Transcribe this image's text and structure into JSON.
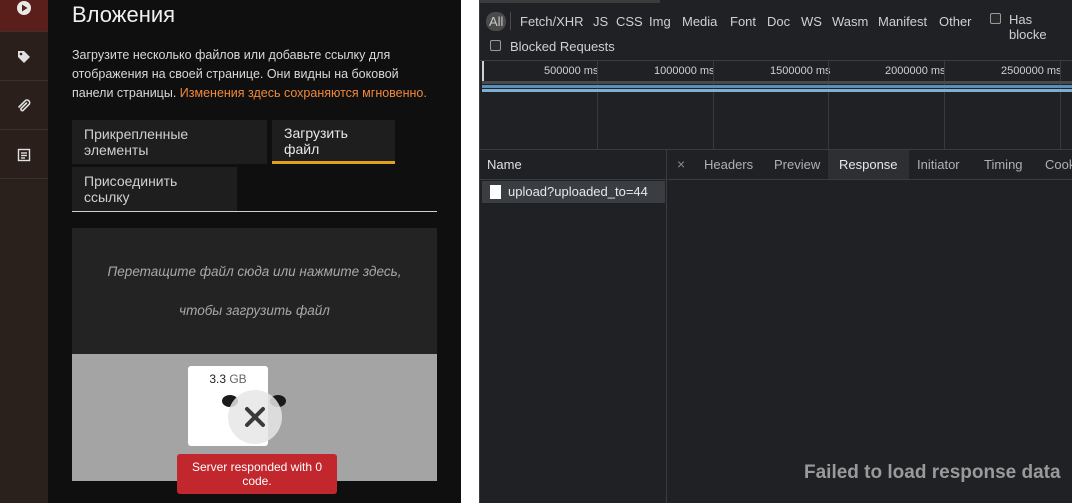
{
  "sidebar": {
    "icons": [
      "play-icon",
      "tag-icon",
      "paperclip-icon",
      "list-icon"
    ]
  },
  "panel": {
    "title": "Вложения",
    "description": "Загрузите несколько файлов или добавьте ссылку для отображения на своей странице. Они видны на боковой панели страницы.",
    "description_highlight": "Изменения здесь сохраняются мгновенно.",
    "tabs": [
      {
        "label": "Прикрепленные элементы"
      },
      {
        "label": "Загрузить файл"
      },
      {
        "label": "Присоединить ссылку"
      }
    ],
    "dropzone": {
      "line1": "Перетащите файл сюда или нажмите здесь,",
      "line2": "чтобы загрузить файл"
    },
    "file": {
      "size": "3.3",
      "unit": "GB",
      "error": "Server responded with 0 code."
    }
  },
  "devtools": {
    "filters": [
      "All",
      "Fetch/XHR",
      "JS",
      "CSS",
      "Img",
      "Media",
      "Font",
      "Doc",
      "WS",
      "Wasm",
      "Manifest",
      "Other"
    ],
    "has_blocked_label": "Has blocke",
    "blocked_requests_label": "Blocked Requests",
    "timeline_ticks": [
      "500000 ms",
      "1000000 ms",
      "1500000 ms",
      "2000000 ms",
      "2500000 ms"
    ],
    "name_header": "Name",
    "request_name": "upload?uploaded_to=44",
    "close_symbol": "×",
    "detail_tabs": [
      "Headers",
      "Preview",
      "Response",
      "Initiator",
      "Timing",
      "Cook"
    ],
    "active_detail_tab": "Response",
    "failed_message": "Failed to load response data"
  },
  "colors": {
    "accent_orange": "#f0883e",
    "active_tab_underline": "#e0a020",
    "error_red": "#c1272d"
  }
}
